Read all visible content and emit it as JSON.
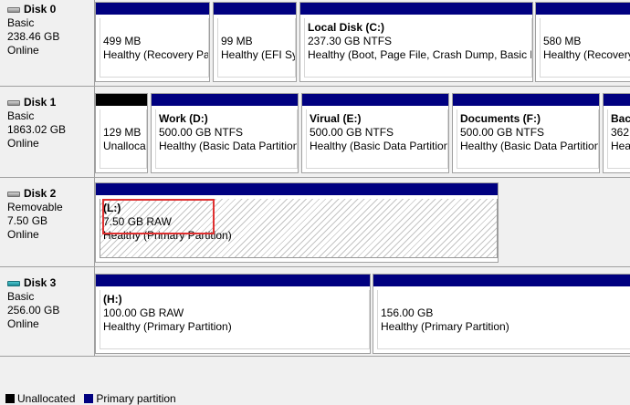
{
  "disks": [
    {
      "name": "Disk 0",
      "type": "Basic",
      "size": "238.46 GB",
      "status": "Online",
      "partitions": [
        {
          "label": "",
          "size": "499 MB",
          "status": "Healthy (Recovery Pa"
        },
        {
          "label": "",
          "size": "99 MB",
          "status": "Healthy (EFI Sy"
        },
        {
          "label": "Local Disk  (C:)",
          "size": "237.30 GB NTFS",
          "status": "Healthy (Boot, Page File, Crash Dump, Basic D"
        },
        {
          "label": "",
          "size": "580 MB",
          "status": "Healthy (Recovery"
        }
      ]
    },
    {
      "name": "Disk 1",
      "type": "Basic",
      "size": "1863.02 GB",
      "status": "Online",
      "partitions": [
        {
          "label": "",
          "size": "129 MB",
          "status": "Unalloca"
        },
        {
          "label": "Work  (D:)",
          "size": "500.00 GB NTFS",
          "status": "Healthy (Basic Data Partition"
        },
        {
          "label": "Virual  (E:)",
          "size": "500.00 GB NTFS",
          "status": "Healthy (Basic Data Partition"
        },
        {
          "label": "Documents  (F:)",
          "size": "500.00 GB NTFS",
          "status": "Healthy (Basic Data Partition"
        },
        {
          "label": "Back",
          "size": "362.8",
          "status": "Heal"
        }
      ]
    },
    {
      "name": "Disk 2",
      "type": "Removable",
      "size": "7.50 GB",
      "status": "Online",
      "partitions": [
        {
          "label": "(L:)",
          "size": "7.50 GB RAW",
          "status": "Healthy (Primary Partition)"
        }
      ]
    },
    {
      "name": "Disk 3",
      "type": "Basic",
      "size": "256.00 GB",
      "status": "Online",
      "partitions": [
        {
          "label": "(H:)",
          "size": "100.00 GB RAW",
          "status": "Healthy (Primary Partition)"
        },
        {
          "label": "",
          "size": "156.00 GB",
          "status": "Healthy (Primary Partition)"
        }
      ]
    }
  ],
  "legend": {
    "unallocated": "Unallocated",
    "primary": "Primary partition"
  },
  "colors": {
    "primary": "#000080",
    "unallocated": "#000000",
    "highlight": "#e03030"
  }
}
